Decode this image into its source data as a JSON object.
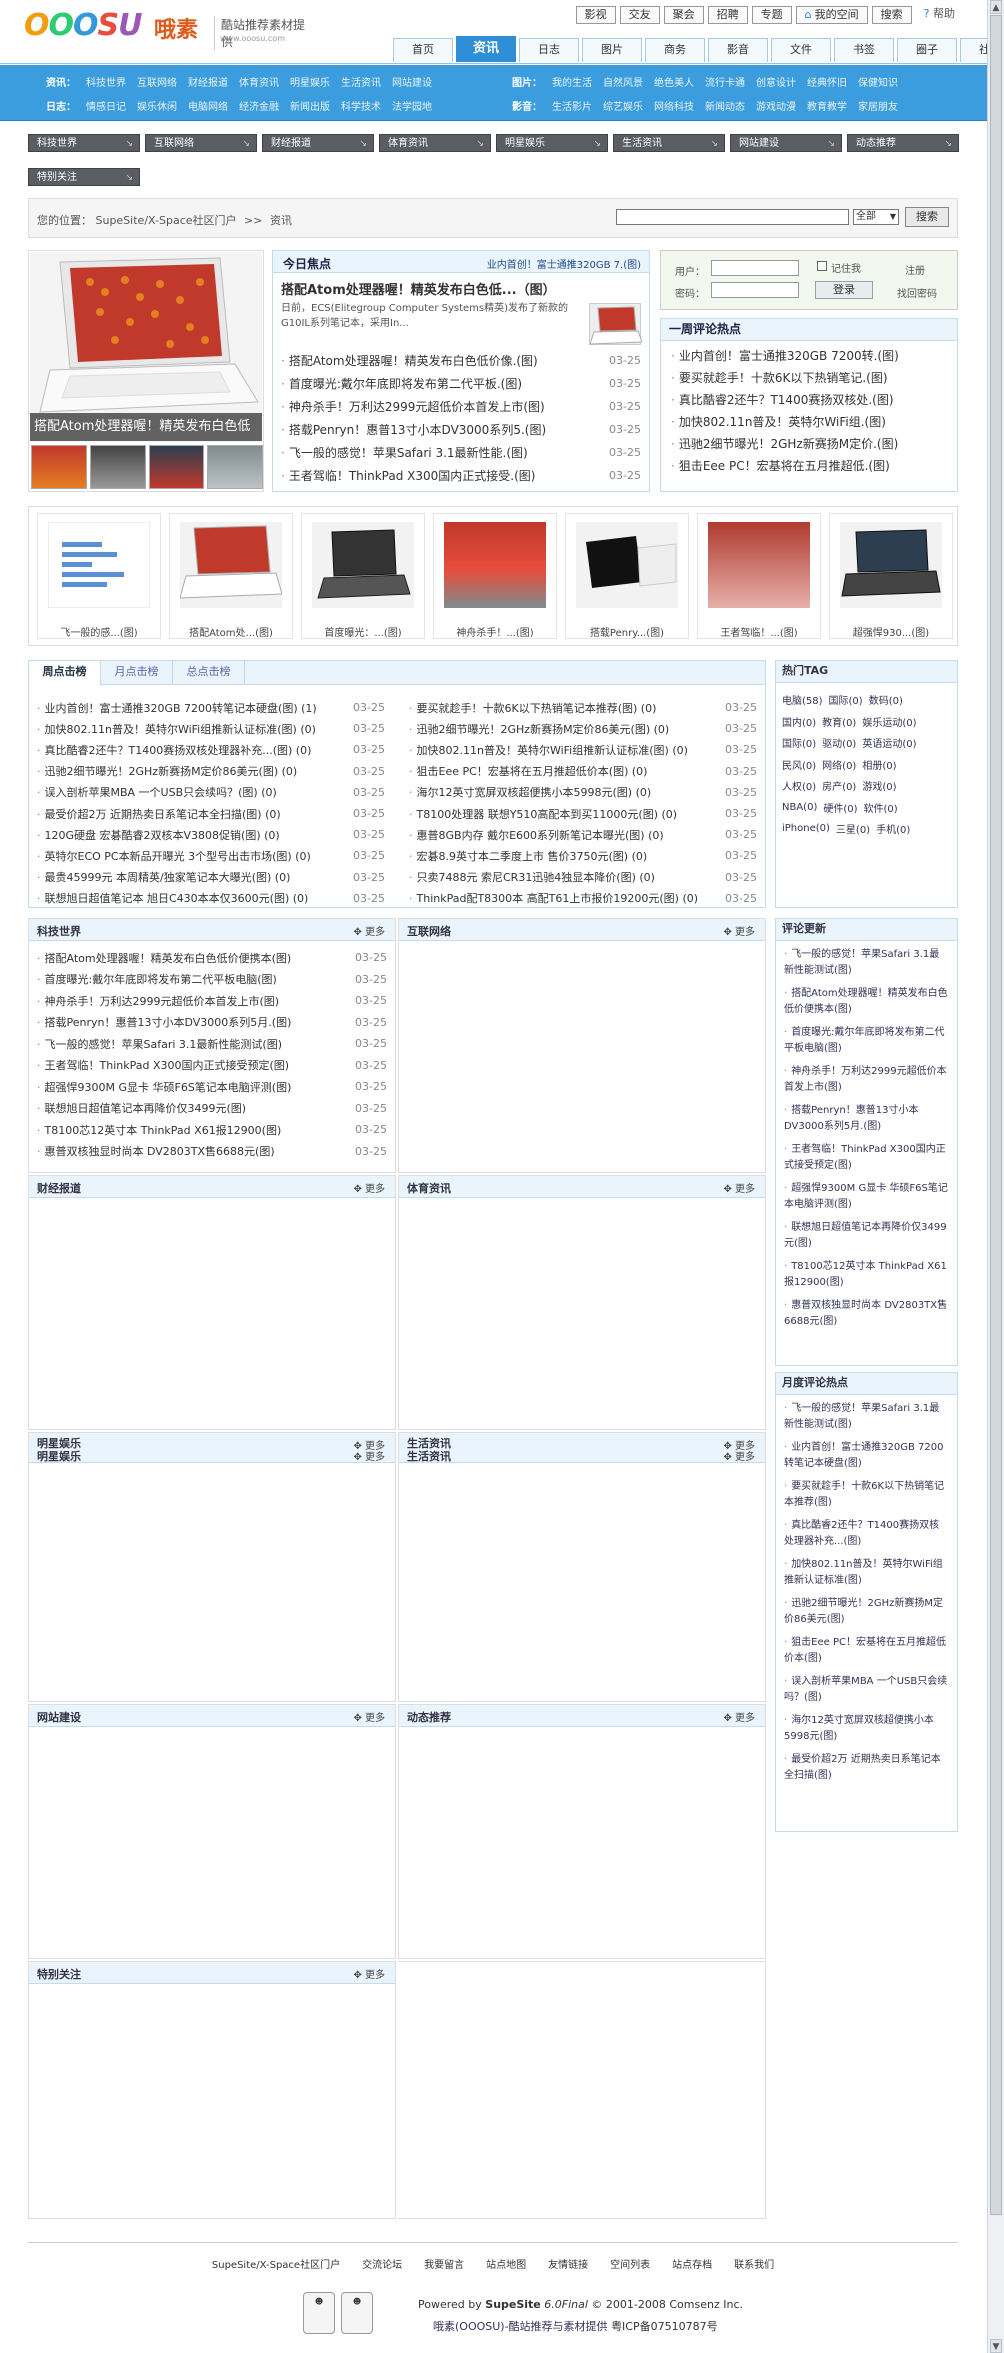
{
  "logo": {
    "brand": "OOOSU",
    "cn": "哦素",
    "slogan": "酷站推荐素材提供",
    "url": "www.ooosu.com"
  },
  "topnav": [
    "影视",
    "交友",
    "聚会",
    "招聘",
    "专题",
    "我的空间",
    "搜索",
    "帮助"
  ],
  "mainnav": [
    "首页",
    "资讯",
    "日志",
    "图片",
    "商务",
    "影音",
    "文件",
    "书签",
    "圈子",
    "社区"
  ],
  "subnav": {
    "left1": {
      "head": "资讯：",
      "items": [
        "科技世界",
        "互联网络",
        "财经报道",
        "体育资讯",
        "明星娱乐",
        "生活资讯",
        "网站建设"
      ]
    },
    "left2": {
      "head": "日志：",
      "items": [
        "情感日记",
        "娱乐休闲",
        "电脑网络",
        "经济金融",
        "新闻出版",
        "科学技术",
        "法学园地"
      ]
    },
    "right1": {
      "head": "图片：",
      "items": [
        "我的生活",
        "自然风景",
        "绝色美人",
        "流行卡通",
        "创意设计",
        "经典怀旧",
        "保健知识"
      ]
    },
    "right2": {
      "head": "影音：",
      "items": [
        "生活影片",
        "综艺娱乐",
        "网络科技",
        "新闻动态",
        "游戏动漫",
        "教育教学",
        "家居朋友"
      ]
    }
  },
  "categories": [
    "科技世界",
    "互联网络",
    "财经报道",
    "体育资讯",
    "明星娱乐",
    "生活资讯",
    "网站建设",
    "动态推荐",
    "特别关注"
  ],
  "location": {
    "label": "您的位置：",
    "path": "SupeSite/X-Space社区门户",
    "sep": ">>",
    "current": "资讯"
  },
  "search": {
    "select": "全部",
    "button": "搜索"
  },
  "focus": {
    "caption": "搭配Atom处理器喔！精英发布白色低"
  },
  "today": {
    "title": "今日焦点",
    "ticker": "业内首创！富士通推320GB 7.(图)",
    "lead": "搭配Atom处理器喔！精英发布白色低...（图）",
    "desc": "日前，ECS(Elitegroup Computer Systems精英)发布了新款的G10IL系列笔记本，采用In...",
    "list": [
      {
        "t": "搭配Atom处理器喔！精英发布白色低价像.(图)",
        "d": "03-25"
      },
      {
        "t": "首度曝光:戴尔年底即将发布第二代平板.(图)",
        "d": "03-25"
      },
      {
        "t": "神舟杀手！万利达2999元超低价本首发上市(图)",
        "d": "03-25"
      },
      {
        "t": "搭载Penryn！惠普13寸小本DV3000系列5.(图)",
        "d": "03-25"
      },
      {
        "t": "飞一般的感觉！苹果Safari 3.1最新性能.(图)",
        "d": "03-25"
      },
      {
        "t": "王者驾临！ThinkPad X300国内正式接受.(图)",
        "d": "03-25"
      }
    ]
  },
  "login": {
    "user": "用户：",
    "pass": "密码：",
    "remember": "记住我",
    "submit": "登录",
    "register": "注册",
    "forgot": "找回密码"
  },
  "weekhot": {
    "title": "一周评论热点",
    "items": [
      "业内首创！富士通推320GB 7200转.(图)",
      "要买就趁手！十款6K以下热销笔记.(图)",
      "真比酷睿2还牛？T1400赛扬双核处.(图)",
      "加快802.11n普及！英特尔WiFi组.(图)",
      "迅驰2细节曝光！2GHz新赛扬M定价.(图)",
      "狙击Eee PC！宏基将在五月推超低.(图)"
    ]
  },
  "strip": [
    {
      "cap": "飞一般的感...(图)"
    },
    {
      "cap": "搭配Atom处...(图)"
    },
    {
      "cap": "首度曝光：...(图)"
    },
    {
      "cap": "神舟杀手！...(图)"
    },
    {
      "cap": "搭载Penry...(图)"
    },
    {
      "cap": "王者驾临！...(图)"
    },
    {
      "cap": "超强悍930...(图)"
    }
  ],
  "hottabs": {
    "tabs": [
      "周点击榜",
      "月点击榜",
      "总点击榜"
    ],
    "left": [
      {
        "t": "业内首创！富士通推320GB 7200转笔记本硬盘(图) (1)",
        "d": "03-25"
      },
      {
        "t": "加快802.11n普及！英特尔WiFi组推新认证标准(图) (0)",
        "d": "03-25"
      },
      {
        "t": "真比酷睿2还牛？T1400赛扬双核处理器补充...(图) (0)",
        "d": "03-25"
      },
      {
        "t": "迅驰2细节曝光！2GHz新赛扬M定价86美元(图) (0)",
        "d": "03-25"
      },
      {
        "t": "误入剖析苹果MBA 一个USB只会续吗？(图) (0)",
        "d": "03-25"
      },
      {
        "t": "最受价超2万 近期热卖日系笔记本全扫描(图) (0)",
        "d": "03-25"
      },
      {
        "t": "120G硬盘 宏碁酷睿2双核本V3808促销(图) (0)",
        "d": "03-25"
      },
      {
        "t": "英特尔ECO PC本新品开曝光 3个型号出击市场(图) (0)",
        "d": "03-25"
      },
      {
        "t": "最贵45999元 本周精英/独家笔记本大曝光(图) (0)",
        "d": "03-25"
      },
      {
        "t": "联想旭日超值笔记本 旭日C430本本仅3600元(图) (0)",
        "d": "03-25"
      }
    ],
    "right": [
      {
        "t": "要买就趁手！十款6K以下热销笔记本推荐(图) (0)",
        "d": "03-25"
      },
      {
        "t": "迅驰2细节曝光！2GHz新赛扬M定价86美元(图) (0)",
        "d": "03-25"
      },
      {
        "t": "加快802.11n普及！英特尔WiFi组推新认证标准(图) (0)",
        "d": "03-25"
      },
      {
        "t": "狙击Eee PC！宏基将在五月推超低价本(图) (0)",
        "d": "03-25"
      },
      {
        "t": "海尔12英寸宽屏双核超便携小本5998元(图) (0)",
        "d": "03-25"
      },
      {
        "t": "T8100处理器 联想Y510高配本到买11000元(图) (0)",
        "d": "03-25"
      },
      {
        "t": "惠普8GB内存 戴尔E600系列新笔记本曝光(图) (0)",
        "d": "03-25"
      },
      {
        "t": "宏碁8.9英寸本二季度上市 售价3750元(图) (0)",
        "d": "03-25"
      },
      {
        "t": "只卖7488元 索尼CR31迅驰4独显本降价(图) (0)",
        "d": "03-25"
      },
      {
        "t": "ThinkPad配T8300本 高配T61上市报价19200元(图) (0)",
        "d": "03-25"
      }
    ]
  },
  "hottag": {
    "title": "热门TAG",
    "rows": [
      [
        "电脑(58)",
        "国际(0)",
        "数码(0)"
      ],
      [
        "国内(0)",
        "教育(0)",
        "娱乐运动(0)"
      ],
      [
        "国际(0)",
        "驱动(0)",
        "英语运动(0)"
      ],
      [
        "民风(0)",
        "网络(0)",
        "相册(0)"
      ],
      [
        "人权(0)",
        "房产(0)",
        "游戏(0)"
      ],
      [
        "NBA(0)",
        "硬件(0)",
        "软件(0)"
      ],
      [
        "iPhone(0)",
        "三星(0)",
        "手机(0)"
      ]
    ]
  },
  "more": "更多",
  "sections": {
    "keji": {
      "title": "科技世界",
      "items": [
        {
          "t": "搭配Atom处理器喔！精英发布白色低价便携本(图)",
          "d": "03-25"
        },
        {
          "t": "首度曝光:戴尔年底即将发布第二代平板电脑(图)",
          "d": "03-25"
        },
        {
          "t": "神舟杀手！万利达2999元超低价本首发上市(图)",
          "d": "03-25"
        },
        {
          "t": "搭载Penryn！惠普13寸小本DV3000系列5月.(图)",
          "d": "03-25"
        },
        {
          "t": "飞一般的感觉！苹果Safari 3.1最新性能测试(图)",
          "d": "03-25"
        },
        {
          "t": "王者驾临！ThinkPad X300国内正式接受预定(图)",
          "d": "03-25"
        },
        {
          "t": "超强悍9300M G显卡 华硕F6S笔记本电脑评测(图)",
          "d": "03-25"
        },
        {
          "t": "联想旭日超值笔记本再降价仅3499元(图)",
          "d": "03-25"
        },
        {
          "t": "T8100芯12英寸本 ThinkPad X61报12900(图)",
          "d": "03-25"
        },
        {
          "t": "惠普双核独显时尚本 DV2803TX售6688元(图)",
          "d": "03-25"
        }
      ]
    },
    "hulian": {
      "title": "互联网络"
    },
    "caijing": {
      "title": "财经报道"
    },
    "tiyu": {
      "title": "体育资讯"
    },
    "mingxing": {
      "title": "明星娱乐"
    },
    "shenghuo": {
      "title": "生活资讯"
    },
    "wangzhan": {
      "title": "网站建设"
    },
    "dongtai": {
      "title": "动态推荐"
    },
    "tebie": {
      "title": "特别关注"
    }
  },
  "comments": {
    "title": "评论更新",
    "items": [
      "飞一般的感觉！苹果Safari 3.1最新性能测试(图)",
      "搭配Atom处理器喔！精英发布白色低价便携本(图)",
      "首度曝光:戴尔年底即将发布第二代平板电脑(图)",
      "神舟杀手！万利达2999元超低价本首发上市(图)",
      "搭载Penryn！惠普13寸小本DV3000系列5月.(图)",
      "王者驾临！ThinkPad X300国内正式接受预定(图)",
      "超强悍9300M G显卡 华硕F6S笔记本电脑评测(图)",
      "联想旭日超值笔记本再降价仅3499元(图)",
      "T8100芯12英寸本 ThinkPad X61报12900(图)",
      "惠普双核独显时尚本 DV2803TX售6688元(图)"
    ]
  },
  "monthhot": {
    "title": "月度评论热点",
    "items": [
      "飞一般的感觉！苹果Safari 3.1最新性能测试(图)",
      "业内首创！富士通推320GB 7200转笔记本硬盘(图)",
      "要买就趁手！十款6K以下热销笔记本推荐(图)",
      "真比酷睿2还牛？T1400赛扬双核处理器补充...(图)",
      "加快802.11n普及！英特尔WiFi组推新认证标准(图)",
      "迅驰2细节曝光！2GHz新赛扬M定价86美元(图)",
      "狙击Eee PC！宏基将在五月推超低价本(图)",
      "误入剖析苹果MBA 一个USB只会续吗？(图)",
      "海尔12英寸宽屏双核超便携小本5998元(图)",
      "最受价超2万 近期热卖日系笔记本全扫描(图)"
    ]
  },
  "footer": {
    "links": [
      "SupeSite/X-Space社区门户",
      "交流论坛",
      "我要留言",
      "站点地图",
      "友情链接",
      "空间列表",
      "站点存档",
      "联系我们"
    ],
    "powered_prefix": "Powered by",
    "powered_product": "SupeSite",
    "powered_version": "6.0Final",
    "powered_suffix": "© 2001-2008 Comsenz Inc.",
    "icp_name": "哦素(OOOSU)-酷站推荐与素材提供",
    "icp_no": "粤ICP备07510787号"
  }
}
